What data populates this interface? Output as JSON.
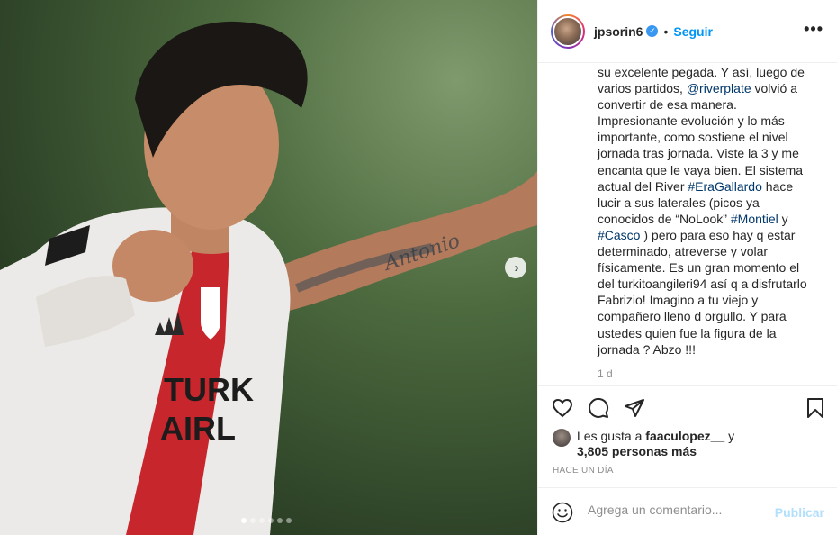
{
  "post": {
    "username": "jpsorin6",
    "follow_label": "Seguir",
    "separator": "•",
    "more_label": "•••"
  },
  "caption": {
    "lines": [
      [
        {
          "t": "su excelente pegada. Y así, luego de"
        }
      ],
      [
        {
          "t": "varios partidos, "
        },
        {
          "t": "@riverplate",
          "link": true
        },
        {
          "t": " volvió a"
        }
      ],
      [
        {
          "t": "convertir de esa manera."
        }
      ],
      [
        {
          "t": "Impresionante evolución y lo más"
        }
      ],
      [
        {
          "t": "importante, como sostiene el nivel"
        }
      ],
      [
        {
          "t": "jornada tras jornada. Viste la 3 y me"
        }
      ],
      [
        {
          "t": "encanta que le vaya bien. El sistema"
        }
      ],
      [
        {
          "t": "actual del River "
        },
        {
          "t": "#EraGallardo",
          "link": true
        },
        {
          "t": " hace"
        }
      ],
      [
        {
          "t": "lucir a sus laterales (picos ya"
        }
      ],
      [
        {
          "t": "conocidos de “NoLook” "
        },
        {
          "t": "#Montiel",
          "link": true
        },
        {
          "t": " y"
        }
      ],
      [
        {
          "t": "#Casco",
          "link": true
        },
        {
          "t": " ) pero para eso hay q estar"
        }
      ],
      [
        {
          "t": "determinado, atreverse y volar"
        }
      ],
      [
        {
          "t": "físicamente. Es un gran momento el"
        }
      ],
      [
        {
          "t": "del turkitoangileri94 así q a disfrutarlo"
        }
      ],
      [
        {
          "t": "Fabrizio! Imagino a tu viejo y"
        }
      ],
      [
        {
          "t": "compañero lleno d orgullo. Y para"
        }
      ],
      [
        {
          "t": "ustedes quien fue la figura de la"
        }
      ],
      [
        {
          "t": "jornada ? Abzo !!!"
        }
      ]
    ],
    "time_ago": "1 d"
  },
  "likes": {
    "prefix": "Les gusta a ",
    "user": "faaculopez__",
    "suffix": " y",
    "count_text": "3,805 personas más"
  },
  "timestamp": "HACE UN DÍA",
  "comment": {
    "placeholder": "Agrega un comentario...",
    "publish_label": "Publicar"
  },
  "media": {
    "jersey_text_line1": "TURK",
    "jersey_text_line2": "AIRL",
    "slide_count": 6,
    "active_slide": 1,
    "tattoo_text": "Antonio"
  }
}
